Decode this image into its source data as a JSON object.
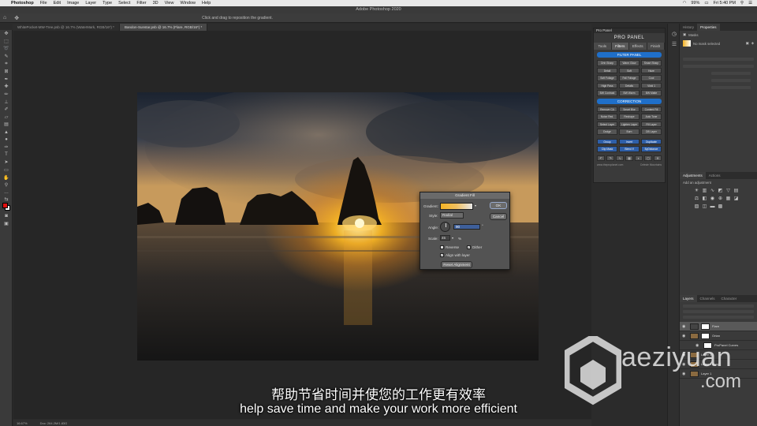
{
  "mac_menu": {
    "app": "Photoshop",
    "items": [
      "File",
      "Edit",
      "Image",
      "Layer",
      "Type",
      "Select",
      "Filter",
      "3D",
      "View",
      "Window",
      "Help"
    ],
    "battery": "99%",
    "clock": "Fri 5:40 PM"
  },
  "window": {
    "title": "Adobe Photoshop 2020"
  },
  "options_bar": {
    "hint": "Click and drag to reposition the gradient."
  },
  "doc_tabs": [
    {
      "label": "WhitePocket-MW-Tree.psb @ 16.7% (WaterMark, RGB/16*) *",
      "active": false
    },
    {
      "label": "Bandon-Sunstar.psb @ 16.7% (Flare, RGB/16*) *",
      "active": true
    }
  ],
  "gradient_dialog": {
    "title": "Gradient Fill",
    "gradient_label": "Gradient:",
    "style_label": "Style:",
    "style_value": "Radial",
    "angle_label": "Angle:",
    "angle_value": "90",
    "scale_label": "Scale:",
    "scale_value": "45",
    "scale_unit": "%",
    "reverse_label": "Reverse",
    "reverse_checked": false,
    "dither_label": "Dither",
    "dither_checked": true,
    "align_label": "Align with layer",
    "align_checked": true,
    "reset_label": "Reset Alignment",
    "ok_label": "OK",
    "cancel_label": "Cancel"
  },
  "pro_panel": {
    "header": "Pro Panel",
    "logo": "PRO PANEL",
    "tabs": [
      {
        "label": "Tools",
        "active": false
      },
      {
        "label": "Filters",
        "active": true
      },
      {
        "label": "Effects",
        "active": false
      },
      {
        "label": "Finish",
        "active": false
      }
    ],
    "filter_section": "FILTER PANEL",
    "filter_buttons": [
      "Ortn Sharp",
      "Warm Glow",
      "Smart Sharp",
      "Detail",
      "Soft",
      "Haze",
      "Vignette",
      "Soft Foliage",
      "Fall Foliage",
      "Cool",
      "Vignette",
      "High Pass",
      "Details",
      "Vivid 1",
      "Vivid 2",
      "BW Contrast",
      "BW Warm",
      "BW Matte"
    ],
    "correction_section": "CORRECTION",
    "correction_buttons": [
      "Remove CA",
      "Smart Blur",
      "Content Fill",
      "Noise Red.",
      "Reshape",
      "Auto Tone",
      "Auto Color",
      "Select Layer",
      "Lighten Layer",
      "Fill Layer",
      "Dodge",
      "Burn",
      "DB Layer",
      "Freq. Sep."
    ],
    "action_buttons": [
      "Group",
      "Invert",
      "Duplicate",
      "Stamp Up",
      "Clip Mask",
      "Blend If",
      "ByDistance",
      "Merge"
    ],
    "footer_left": "www.theproplanet.com",
    "footer_right": "Celeste Mountains"
  },
  "right_panels": {
    "top_tabs": [
      {
        "label": "History",
        "active": false
      },
      {
        "label": "Properties",
        "active": true
      }
    ],
    "properties_masks_label": "Masks",
    "properties_mask_text": "No mask selected",
    "adjust_tabs": [
      {
        "label": "Adjustments",
        "active": true
      },
      {
        "label": "Actions",
        "active": false
      }
    ],
    "adjust_add": "Add an adjustment",
    "layer_tabs": [
      {
        "label": "Layers",
        "active": true
      },
      {
        "label": "Channels",
        "active": false
      },
      {
        "label": "Character",
        "active": false
      }
    ],
    "layers": [
      {
        "name": "Flare",
        "selected": true,
        "mask": true
      },
      {
        "name": "Ortan",
        "selected": false,
        "mask": true
      },
      {
        "name": "ProPanel Curves",
        "selected": false,
        "mask": true
      },
      {
        "name": "Layer 3",
        "selected": false,
        "mask": false
      },
      {
        "name": "Layer 4 copy",
        "selected": false,
        "mask": false
      },
      {
        "name": "Layer 1",
        "selected": false,
        "mask": false
      }
    ]
  },
  "status": {
    "zoom": "16.67%",
    "doc": "Doc: 264.2M/1.83G"
  },
  "subtitles": {
    "cn": "帮助节省时间并使您的工作更有效率",
    "en": "help save time and make your work more efficient"
  },
  "watermark": {
    "line1": "aeziyuan",
    "line2": ".com"
  },
  "colors": {
    "pro_blue": "#1f6fc9",
    "dialog_bg": "#535353",
    "sun": "#f5b323"
  }
}
